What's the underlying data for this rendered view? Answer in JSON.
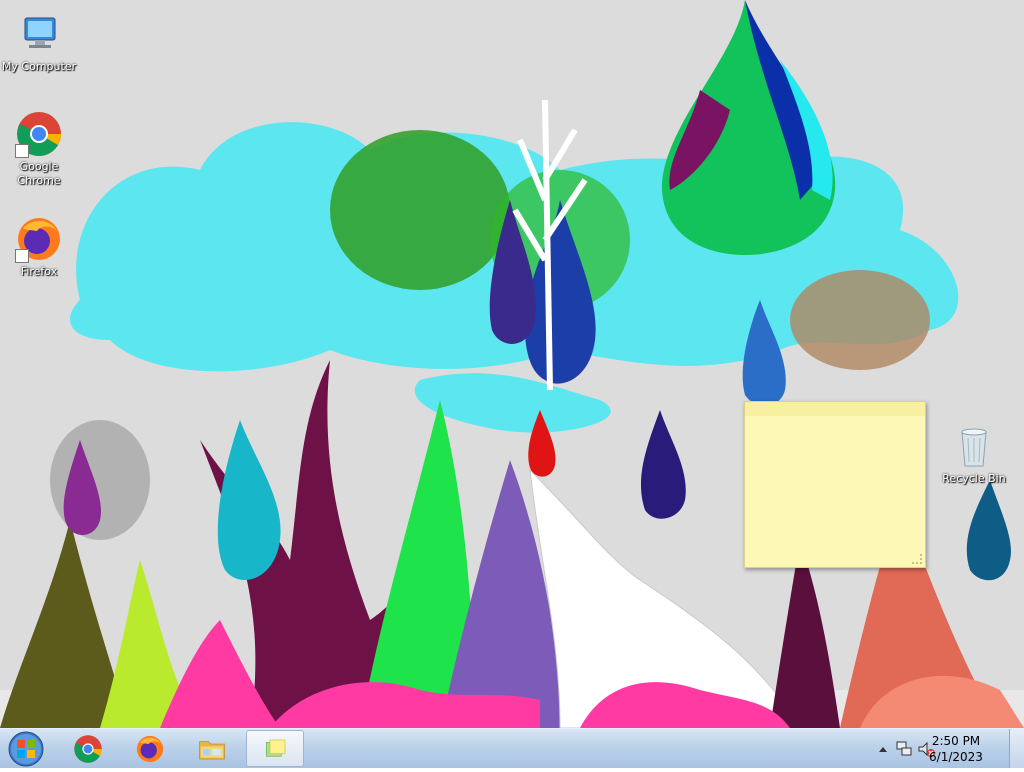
{
  "desktop_icons": [
    {
      "label": "My Computer",
      "icon": "computer-icon"
    },
    {
      "label": "Google Chrome",
      "icon": "chrome-icon"
    },
    {
      "label": "Firefox",
      "icon": "firefox-icon"
    },
    {
      "label": "Recycle Bin",
      "icon": "recycle-bin-icon"
    }
  ],
  "sticky_note": {
    "text": ""
  },
  "taskbar": {
    "start_icon": "windows-logo-icon",
    "pinned": [
      {
        "name": "Google Chrome",
        "icon": "chrome-icon"
      },
      {
        "name": "Firefox",
        "icon": "firefox-icon"
      },
      {
        "name": "Windows Explorer",
        "icon": "folder-icon"
      },
      {
        "name": "Sticky Notes",
        "icon": "sticky-notes-icon",
        "active": true
      }
    ],
    "tray": {
      "icons": [
        "show-hidden-icons-icon",
        "network-icon",
        "volume-muted-icon"
      ],
      "time": "2:50 PM",
      "date": "6/1/2023"
    }
  },
  "colors": {
    "taskbar": "#bcd2ea",
    "sticky_note": "#fdf8b5",
    "wallpaper_bg": "#d9d9d9",
    "wallpaper_cloud": "#5ce6ef"
  }
}
